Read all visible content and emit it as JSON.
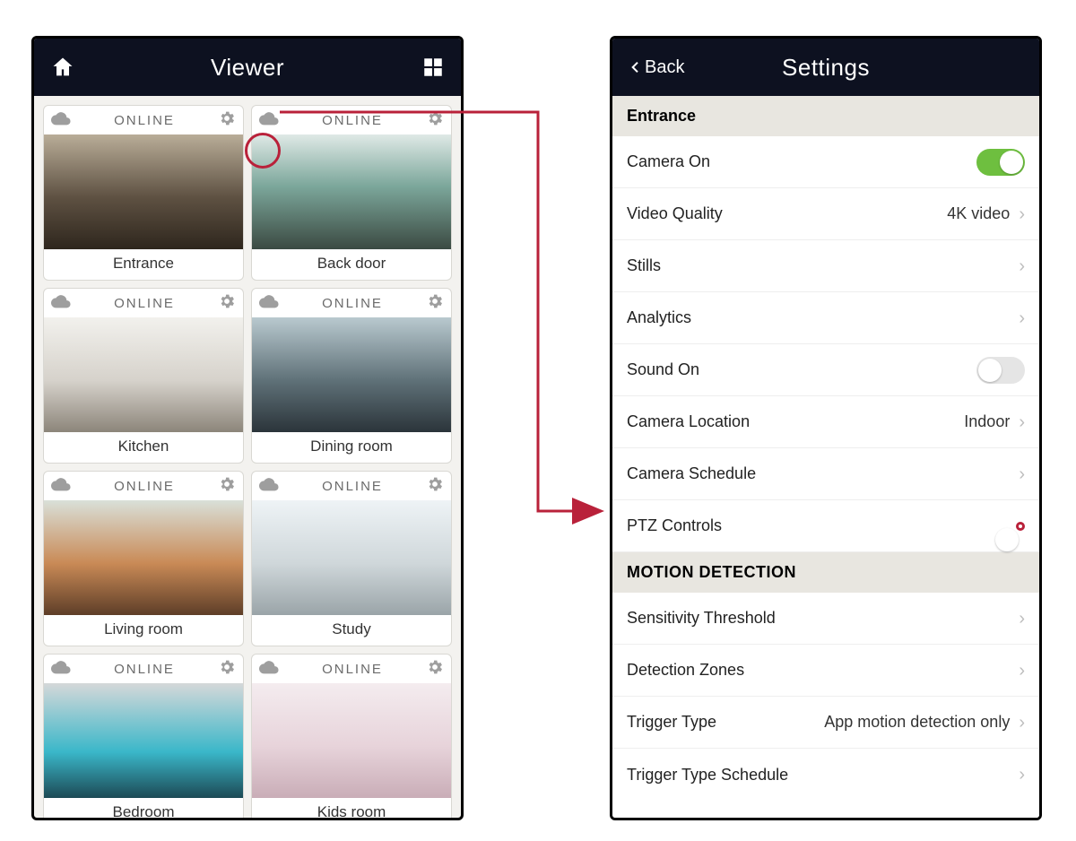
{
  "viewer": {
    "title": "Viewer",
    "cameras": [
      {
        "status": "ONLINE",
        "label": "Entrance",
        "scene": "sc-entrance"
      },
      {
        "status": "ONLINE",
        "label": "Back door",
        "scene": "sc-backdoor"
      },
      {
        "status": "ONLINE",
        "label": "Kitchen",
        "scene": "sc-kitchen"
      },
      {
        "status": "ONLINE",
        "label": "Dining room",
        "scene": "sc-dining"
      },
      {
        "status": "ONLINE",
        "label": "Living room",
        "scene": "sc-living"
      },
      {
        "status": "ONLINE",
        "label": "Study",
        "scene": "sc-study"
      },
      {
        "status": "ONLINE",
        "label": "Bedroom",
        "scene": "sc-bedroom"
      },
      {
        "status": "ONLINE",
        "label": "Kids room",
        "scene": "sc-kids"
      }
    ]
  },
  "settings": {
    "back": "Back",
    "title": "Settings",
    "camera_name": "Entrance",
    "rows": {
      "camera_on": {
        "label": "Camera On"
      },
      "video_quality": {
        "label": "Video Quality",
        "value": "4K video"
      },
      "stills": {
        "label": "Stills"
      },
      "analytics": {
        "label": "Analytics"
      },
      "sound_on": {
        "label": "Sound On"
      },
      "camera_location": {
        "label": "Camera Location",
        "value": "Indoor"
      },
      "camera_schedule": {
        "label": "Camera Schedule"
      },
      "ptz": {
        "label": "PTZ Controls"
      }
    },
    "motion_header": "MOTION DETECTION",
    "motion": {
      "sensitivity": {
        "label": "Sensitivity Threshold"
      },
      "zones": {
        "label": "Detection Zones"
      },
      "trigger_type": {
        "label": "Trigger Type",
        "value": "App motion detection only"
      },
      "trigger_sched": {
        "label": "Trigger Type Schedule"
      }
    }
  }
}
